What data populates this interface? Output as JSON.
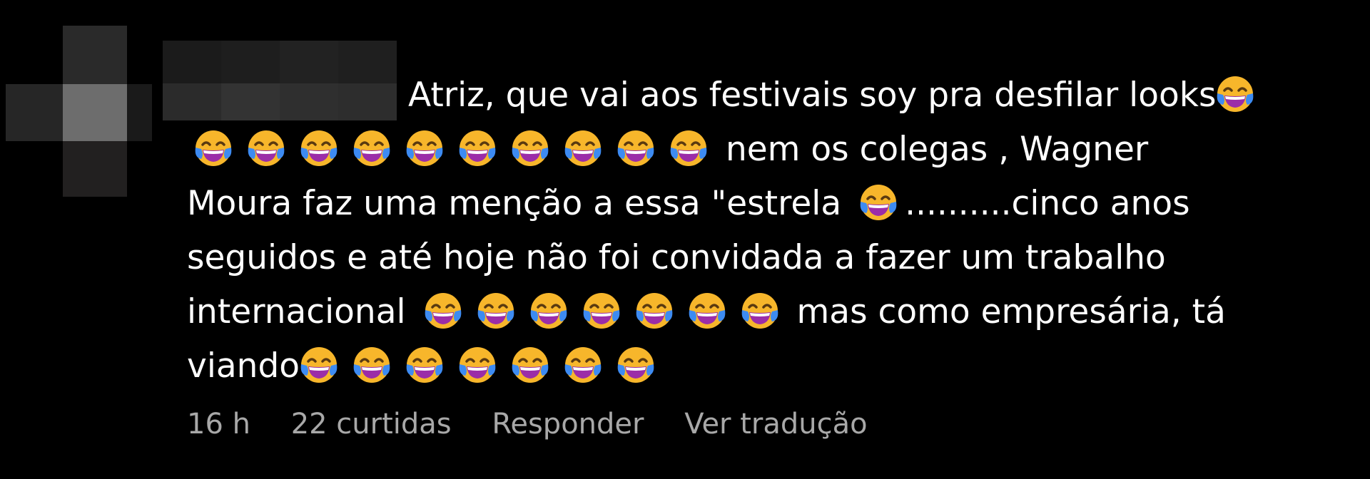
{
  "comment": {
    "line1": {
      "text": "Atriz, que vai aos festivais soy pra desfilar looks",
      "emoji_after": 1
    },
    "line2": {
      "emoji_before": 10,
      "text": "nem os colegas , Wagner"
    },
    "line3": {
      "text_a": "Moura faz uma menção a essa \"estrela",
      "emoji_mid": 1,
      "text_b": "..........cinco anos"
    },
    "line4": {
      "text": "seguidos e até hoje não foi convidada a fazer um trabalho"
    },
    "line5": {
      "text_a": "internacional",
      "emoji_mid": 7,
      "text_b": "mas como empresária, tá"
    },
    "line6": {
      "text": "viando",
      "emoji_after": 7
    }
  },
  "emoji_icon": "face-with-tears-of-joy-icon",
  "footer": {
    "time": "16 h",
    "likes": "22 curtidas",
    "reply": "Responder",
    "translate": "Ver tradução"
  },
  "colors": {
    "background": "#000000",
    "text": "#ffffff",
    "meta": "#a8a8a8",
    "emoji_face": "#f7b62b",
    "emoji_tears": "#3d8bf2",
    "emoji_mouth": "#9b2da8"
  }
}
